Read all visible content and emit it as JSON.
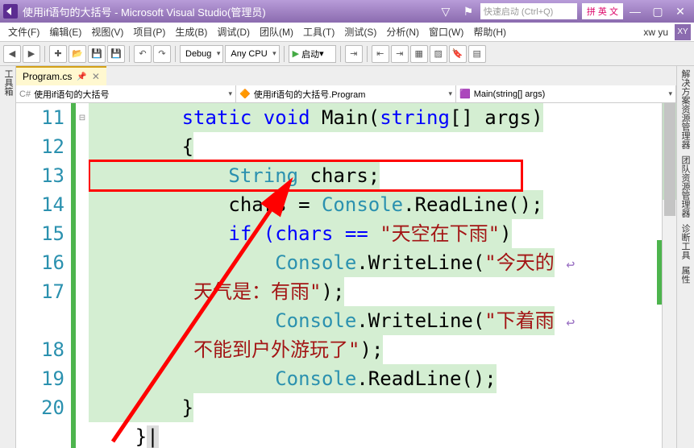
{
  "titlebar": {
    "title": "使用if语句的大括号 - Microsoft Visual Studio(管理员)",
    "quick_launch": "快速启动 (Ctrl+Q)",
    "ime": "拼 英 文"
  },
  "menu": {
    "file": "文件(F)",
    "edit": "编辑(E)",
    "view": "视图(V)",
    "project": "项目(P)",
    "build": "生成(B)",
    "debug": "调试(D)",
    "team": "团队(M)",
    "tools": "工具(T)",
    "test": "测试(S)",
    "analyze": "分析(N)",
    "window": "窗口(W)",
    "help": "帮助(H)",
    "user": "xw yu",
    "user_initials": "XY"
  },
  "toolbar": {
    "config": "Debug",
    "platform": "Any CPU",
    "run": "启动"
  },
  "left_panel": {
    "toolbox": "工具箱"
  },
  "right_panel": {
    "solution": "解决方案资源管理器",
    "team": "团队资源管理器",
    "diag": "诊断工具",
    "props": "属性"
  },
  "tab": {
    "name": "Program.cs"
  },
  "nav": {
    "namespace": "使用if语句的大括号",
    "class": "使用if语句的大括号.Program",
    "method": "Main(string[] args)"
  },
  "lines": [
    "11",
    "12",
    "13",
    "14",
    "15",
    "16",
    "17",
    "18",
    "19",
    "20"
  ],
  "code": {
    "l11_p1": "        static void ",
    "l11_m": "Main",
    "l11_p2": "(",
    "l11_t": "string",
    "l11_p3": "[] args)",
    "l12": "        {",
    "l13_p1": "            ",
    "l13_t": "String",
    "l13_p2": " chars;",
    "l14_p1": "            chars = ",
    "l14_t": "Console",
    "l14_p2": ".ReadLine();",
    "l15_p1": "            if (chars == ",
    "l15_s": "\"天空在下雨\"",
    "l15_p2": ")",
    "l16_p1": "                ",
    "l16_t": "Console",
    "l16_p2": ".WriteLine(",
    "l16_s": "\"今天的",
    "l16_s2": "天气是：有雨\"",
    "l16_p3": ");",
    "l17_p1": "                ",
    "l17_t": "Console",
    "l17_p2": ".WriteLine(",
    "l17_s": "\"下着雨",
    "l17_s2": "不能到户外游玩了\"",
    "l17_p3": ");",
    "l18_p1": "                ",
    "l18_t": "Console",
    "l18_p2": ".ReadLine();",
    "l19": "        }",
    "l20": "    }"
  }
}
